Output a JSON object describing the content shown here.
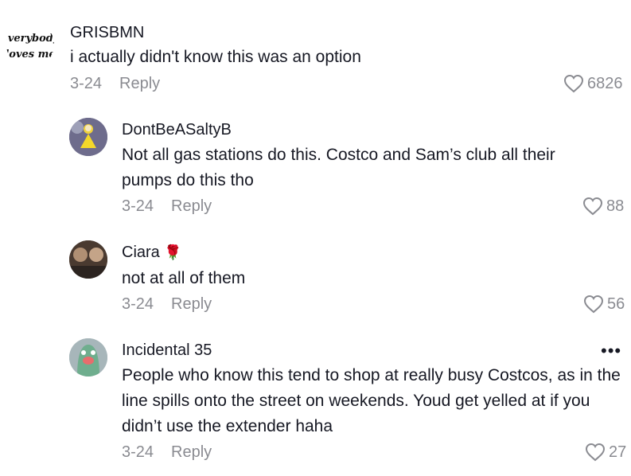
{
  "comments": [
    {
      "username": "GRISBMN",
      "text": "i actually didn't know this was an option",
      "date": "3-24",
      "reply_label": "Reply",
      "likes": "6826",
      "avatar_text": [
        "everybody",
        "loves me"
      ]
    },
    {
      "username": "DontBeASaltyB",
      "text": "Not all gas stations do this. Costco and Sam’s club all their pumps do this tho",
      "date": "3-24",
      "reply_label": "Reply",
      "likes": "88"
    },
    {
      "username": "Ciara",
      "emoji": "🌹",
      "text": "not at all of them",
      "date": "3-24",
      "reply_label": "Reply",
      "likes": "56"
    },
    {
      "username": "Incidental 35",
      "text": "People who know this tend to shop at really busy Costcos, as in the line spills onto the street on weekends. Youd get yelled at if you didn’t use the extender haha",
      "date": "3-24",
      "reply_label": "Reply",
      "likes": "27",
      "more_icon": "•••"
    }
  ],
  "colors": {
    "primary_text": "#161823",
    "secondary_text": "#8a8b91",
    "background": "#ffffff"
  }
}
